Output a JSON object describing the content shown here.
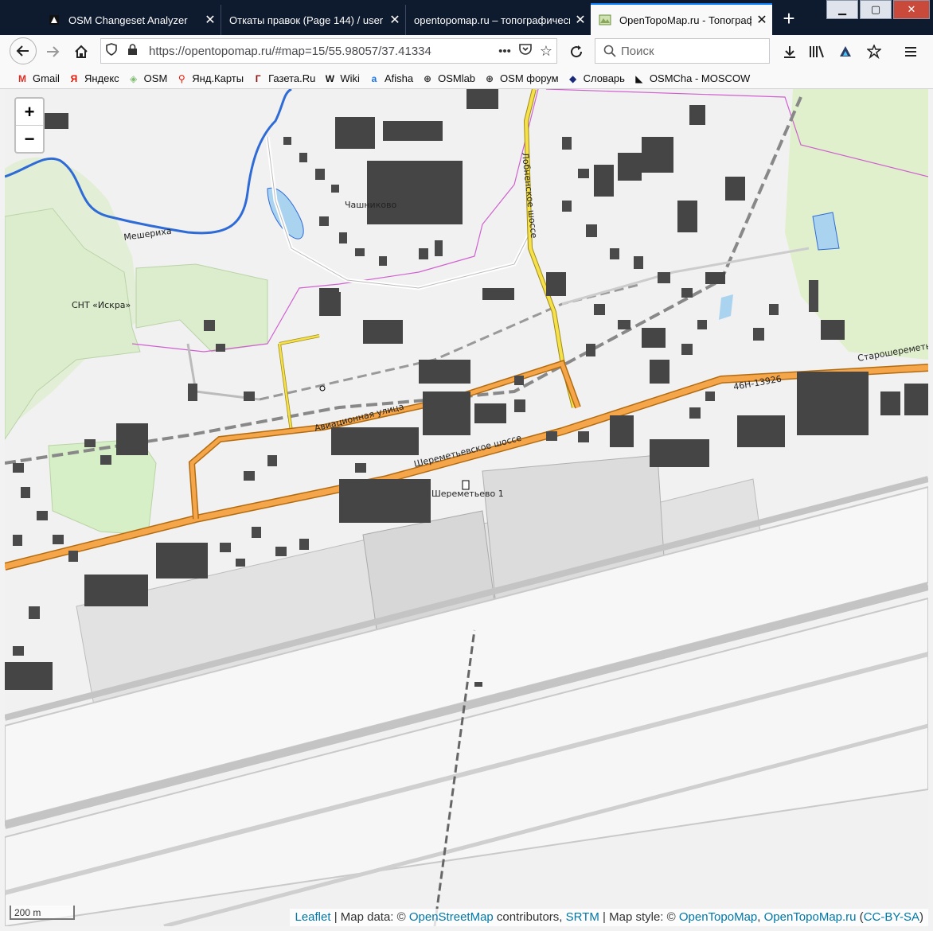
{
  "browser": {
    "tabs": [
      {
        "title": "OSM Changeset Analyzer",
        "icon": "osmcha-icon",
        "active": false
      },
      {
        "title": "Откаты правок (Page 144) / user",
        "icon": "",
        "active": false
      },
      {
        "title": "opentopomap.ru – топографическая",
        "icon": "",
        "active": false
      },
      {
        "title": "OpenTopoMap.ru - Топография",
        "icon": "map-icon",
        "active": true
      }
    ],
    "window_buttons": {
      "minimize": "▁",
      "maximize": "▢",
      "close": "✕"
    },
    "url": "https://opentopomap.ru/#map=15/55.98057/37.41334",
    "search_placeholder": "Поиск",
    "bookmarks": [
      {
        "label": "Gmail",
        "glyph": "M",
        "color": "#d93025"
      },
      {
        "label": "Яндекс",
        "glyph": "Я",
        "color": "#e61400"
      },
      {
        "label": "OSM",
        "glyph": "◈",
        "color": "#7ebc6f"
      },
      {
        "label": "Янд.Карты",
        "glyph": "⚲",
        "color": "#e61400"
      },
      {
        "label": "Газета.Ru",
        "glyph": "Г",
        "color": "#8b1010"
      },
      {
        "label": "Wiki",
        "glyph": "W",
        "color": "#111111"
      },
      {
        "label": "Afisha",
        "glyph": "a",
        "color": "#1a73e8"
      },
      {
        "label": "OSMlab",
        "glyph": "⊕",
        "color": "#333333"
      },
      {
        "label": "OSM форум",
        "glyph": "⊕",
        "color": "#333333"
      },
      {
        "label": "Словарь",
        "glyph": "◆",
        "color": "#1a2a7a"
      },
      {
        "label": "OSMCha - MOSCOW",
        "glyph": "◣",
        "color": "#111111"
      }
    ]
  },
  "map": {
    "zoom_in": "+",
    "zoom_out": "−",
    "scale_label": "200 m",
    "labels": {
      "meshericha": "Мешериха",
      "chashnikovo": "Чашниково",
      "snt_iskra": "СНТ «Искра»",
      "lobnenskoe": "Лобненское шоссе",
      "aviatsionnaya": "Авиационная улица",
      "sheremetyevskoe": "Шереметьевское шоссе",
      "sheremetyevo1": "Шереметьево 1",
      "road_ref": "46Н-13926",
      "staroshere": "Старошереметьевское"
    },
    "attribution": {
      "leaflet": "Leaflet",
      "sep1": " | Map data: © ",
      "osm": "OpenStreetMap",
      "contrib": " contributors, ",
      "srtm": "SRTM",
      "style": " | Map style: © ",
      "otm": "OpenTopoMap",
      "comma": ", ",
      "otmru": "OpenTopoMap.ru",
      "ccopen": " (",
      "cc": "CC-BY-SA",
      "ccclose": ")"
    }
  }
}
